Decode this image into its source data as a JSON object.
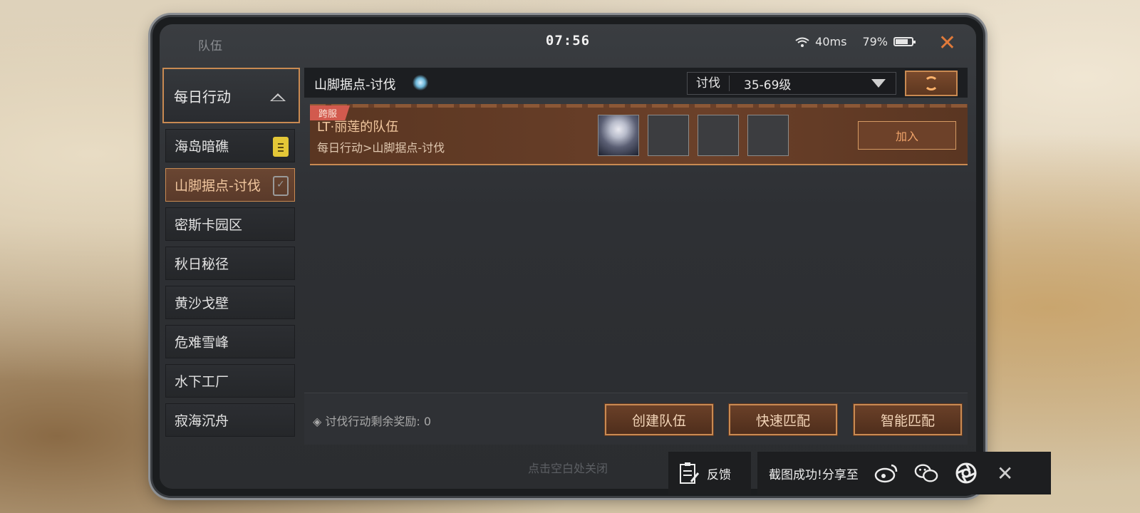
{
  "window": {
    "title": "队伍",
    "clock": "07:56",
    "ping": "40ms",
    "battery": "79%",
    "battery_level": 0.79
  },
  "sidebar": {
    "category": "每日行动",
    "items": [
      {
        "label": "海岛暗礁",
        "badge": "yellow"
      },
      {
        "label": "山脚据点-讨伐",
        "badge": "check",
        "active": true
      },
      {
        "label": "密斯卡园区"
      },
      {
        "label": "秋日秘径"
      },
      {
        "label": "黄沙戈壁"
      },
      {
        "label": "危难雪峰"
      },
      {
        "label": "水下工厂"
      },
      {
        "label": "寂海沉舟"
      }
    ]
  },
  "main": {
    "mode_title": "山脚据点-讨伐",
    "filter": {
      "label": "讨伐",
      "value": "35-69级"
    },
    "team": {
      "tag": "跨服",
      "name": "LT·丽莲的队伍",
      "path": "每日行动>山脚据点-讨伐",
      "join_label": "加入"
    },
    "reward_text": "讨伐行动剩余奖励: 0",
    "buttons": {
      "create": "创建队伍",
      "quick_match": "快速匹配",
      "smart_match": "智能匹配"
    }
  },
  "dismiss_hint": "点击空白处关闭",
  "overlay": {
    "feedback": "反馈",
    "share_text": "截图成功!分享至"
  },
  "colors": {
    "accent": "#c98a52",
    "accent_text": "#f1c79f",
    "danger_tag": "#d25a4e",
    "close": "#e07a3a"
  }
}
